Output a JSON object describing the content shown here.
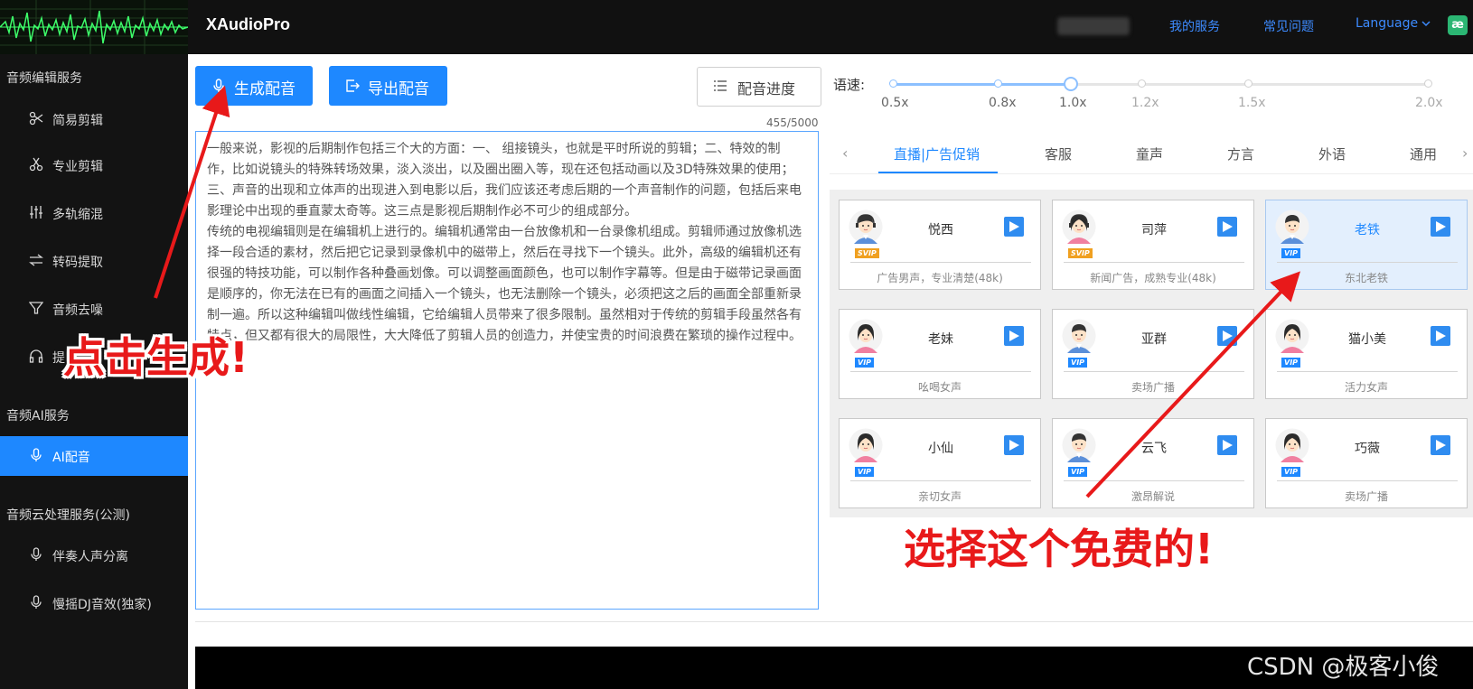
{
  "app": {
    "title": "XAudioPro",
    "nav": {
      "my_services": "我的服务",
      "faq": "常见问题",
      "language": "Language"
    },
    "badge": "æ"
  },
  "sidebar": {
    "groups": [
      {
        "title": "音频编辑服务",
        "items": [
          {
            "label": "简易剪辑",
            "icon": "scissors-icon"
          },
          {
            "label": "专业剪辑",
            "icon": "scissors-alt-icon"
          },
          {
            "label": "多轨缩混",
            "icon": "mixer-icon"
          },
          {
            "label": "转码提取",
            "icon": "swap-icon"
          },
          {
            "label": "音频去噪",
            "icon": "filter-icon"
          },
          {
            "label": "提",
            "icon": "headphones-icon"
          }
        ]
      },
      {
        "title": "音频AI服务",
        "items": [
          {
            "label": "AI配音",
            "icon": "microphone-icon",
            "active": true
          }
        ]
      },
      {
        "title": "音频云处理服务(公测)",
        "items": [
          {
            "label": "伴奏人声分离",
            "icon": "microphone-icon"
          },
          {
            "label": "慢摇DJ音效(独家)",
            "icon": "microphone-icon"
          }
        ]
      }
    ]
  },
  "toolbar": {
    "generate_label": "生成配音",
    "export_label": "导出配音",
    "progress_label": "配音进度"
  },
  "editor": {
    "char_count": "455/5000",
    "text": "一般来说，影视的后期制作包括三个大的方面：一、 组接镜头，也就是平时所说的剪辑；二、特效的制作，比如说镜头的特殊转场效果，淡入淡出，以及圈出圈入等，现在还包括动画以及3D特殊效果的使用；三、声音的出现和立体声的出现进入到电影以后，我们应该还考虑后期的一个声音制作的问题，包括后来电影理论中出现的垂直蒙太奇等。这三点是影视后期制作必不可少的组成部分。\n传统的电视编辑则是在编辑机上进行的。编辑机通常由一台放像机和一台录像机组成。剪辑师通过放像机选择一段合适的素材，然后把它记录到录像机中的磁带上，然后在寻找下一个镜头。此外，高级的编辑机还有很强的特技功能，可以制作各种叠画划像。可以调整画面颜色，也可以制作字幕等。但是由于磁带记录画面是顺序的，你无法在已有的画面之间插入一个镜头，也无法删除一个镜头，必须把这之后的画面全部重新录制一遍。所以这种编辑叫做线性编辑，它给编辑人员带来了很多限制。虽然相对于传统的剪辑手段虽然各有特点，但又都有很大的局限性，大大降低了剪辑人员的创造力，并使宝贵的时间浪费在繁琐的操作过程中。"
  },
  "speed": {
    "label": "语速:",
    "ticks": [
      "0.5x",
      "0.8x",
      "1.0x",
      "1.2x",
      "1.5x",
      "2.0x"
    ],
    "selected": "1.0x"
  },
  "tabs": {
    "items": [
      "直播|广告促销",
      "客服",
      "童声",
      "方言",
      "外语",
      "通用"
    ],
    "active": 0,
    "prev_icon": "chevron-left-icon",
    "next_icon": "chevron-right-icon"
  },
  "voices": [
    {
      "name": "悦西",
      "desc": "广告男声，专业清楚(48k)",
      "badge": "SVIP",
      "gender": "male-headset"
    },
    {
      "name": "司萍",
      "desc": "新闻广告，成熟专业(48k)",
      "badge": "SVIP",
      "gender": "female-headset"
    },
    {
      "name": "老铁",
      "desc": "东北老铁",
      "badge": "VIP",
      "gender": "male",
      "selected": true
    },
    {
      "name": "老妹",
      "desc": "吆喝女声",
      "badge": "VIP",
      "gender": "female"
    },
    {
      "name": "亚群",
      "desc": "卖场广播",
      "badge": "VIP",
      "gender": "male"
    },
    {
      "name": "猫小美",
      "desc": "活力女声",
      "badge": "VIP",
      "gender": "female"
    },
    {
      "name": "小仙",
      "desc": "亲切女声",
      "badge": "VIP",
      "gender": "female"
    },
    {
      "name": "云飞",
      "desc": "激昂解说",
      "badge": "VIP",
      "gender": "male"
    },
    {
      "name": "巧薇",
      "desc": "卖场广播",
      "badge": "VIP",
      "gender": "female"
    }
  ],
  "annotations": {
    "click_generate": "点击生成!",
    "choose_free": "选择这个免费的!"
  },
  "watermark": "CSDN @极客小俊",
  "colors": {
    "accent": "#1e88ff",
    "annotation": "#e8191a",
    "svip": "#f0a020",
    "sidebar_bg": "#131313"
  }
}
